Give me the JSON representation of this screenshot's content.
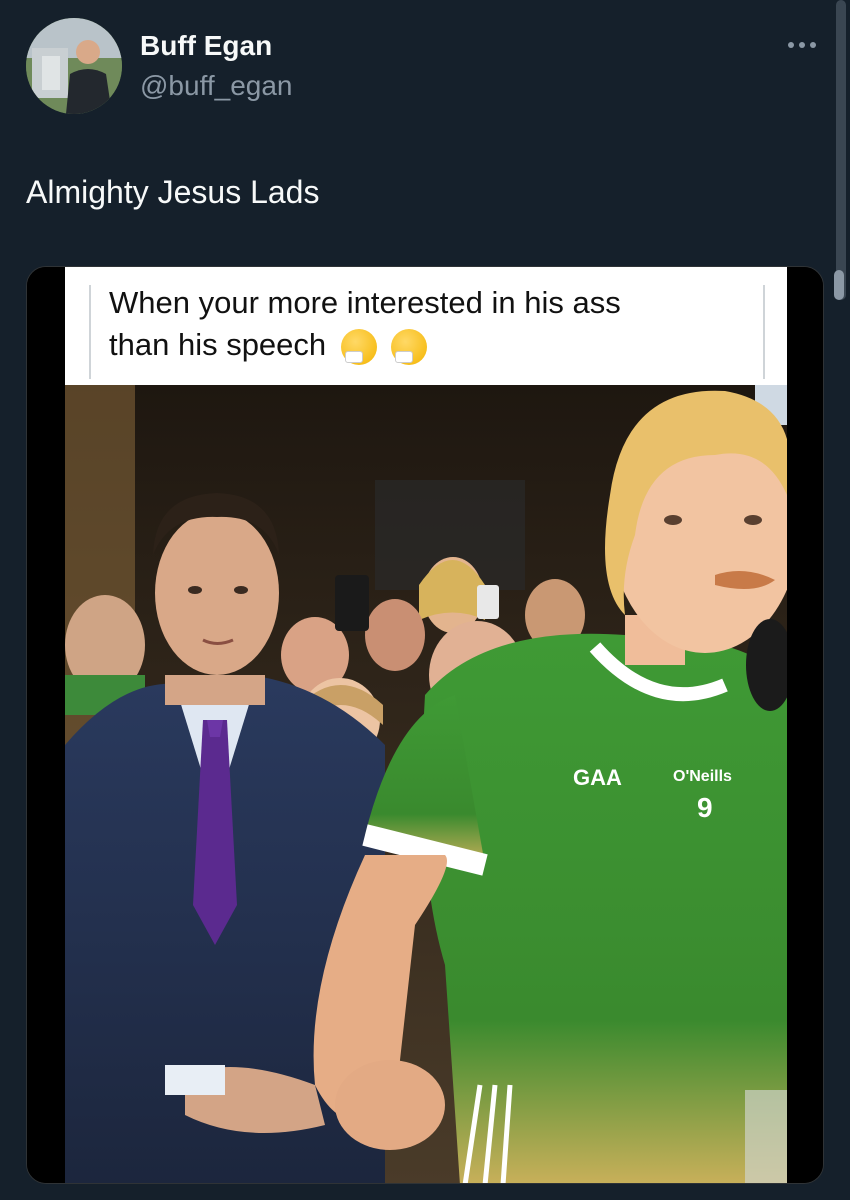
{
  "author": {
    "display_name": "Buff Egan",
    "handle": "@buff_egan"
  },
  "tweet": {
    "text": "Almighty Jesus Lads"
  },
  "more_icon": "more-horizontal-icon",
  "meme": {
    "caption_line_1": "When your more interested in his ass",
    "caption_line_2": "than his speech",
    "emoji": "thinking-face-emoji",
    "jersey_crest": "GAA",
    "jersey_brand": "O'Neills",
    "jersey_number": "9"
  },
  "colors": {
    "background": "#15202b",
    "primary_text": "#f7f9f9",
    "secondary_text": "#8b98a5",
    "jersey_green": "#3a8a2e"
  }
}
